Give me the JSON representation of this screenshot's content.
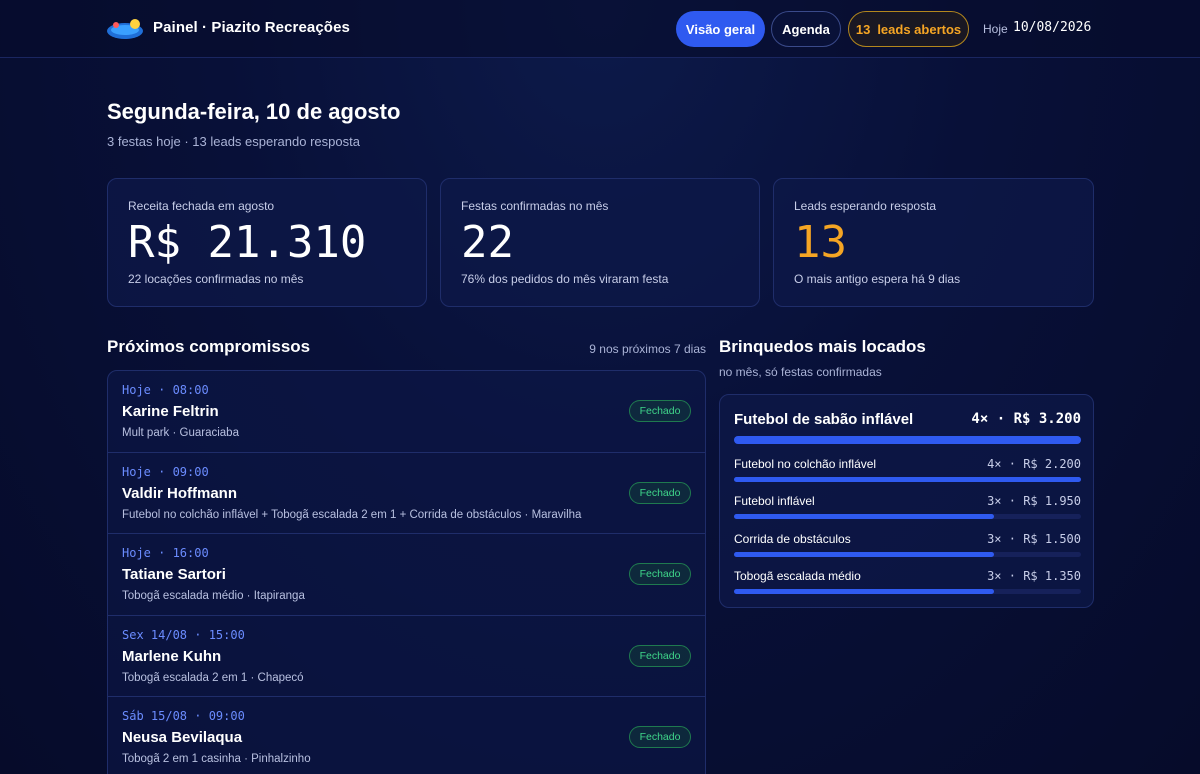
{
  "header": {
    "brand": "Painel · Piazito Recreações",
    "nav": {
      "overview": "Visão geral",
      "agenda": "Agenda",
      "leads_count": "13",
      "leads_label": "leads abertos"
    },
    "today_label": "Hoje",
    "today_date": "10/08/2026"
  },
  "page": {
    "title": "Segunda-feira, 10 de agosto",
    "subtitle": "3 festas hoje · 13 leads esperando resposta"
  },
  "kpis": [
    {
      "label": "Receita fechada em agosto",
      "value": "R$ 21.310",
      "note": "22 locações confirmadas no mês"
    },
    {
      "label": "Festas confirmadas no mês",
      "value": "22",
      "note": "76% dos pedidos do mês viraram festa"
    },
    {
      "label": "Leads esperando resposta",
      "value": "13",
      "note": "O mais antigo espera há 9 dias"
    }
  ],
  "appointments": {
    "title": "Próximos compromissos",
    "meta": "9 nos próximos 7 dias",
    "items": [
      {
        "time": "Hoje · 08:00",
        "name": "Karine Feltrin",
        "desc": "Mult park · Guaraciaba",
        "status": "Fechado"
      },
      {
        "time": "Hoje · 09:00",
        "name": "Valdir Hoffmann",
        "desc": "Futebol no colchão inflável + Tobogã escalada 2 em 1 + Corrida de obstáculos · Maravilha",
        "status": "Fechado"
      },
      {
        "time": "Hoje · 16:00",
        "name": "Tatiane Sartori",
        "desc": "Tobogã escalada médio · Itapiranga",
        "status": "Fechado"
      },
      {
        "time": "Sex 14/08 · 15:00",
        "name": "Marlene Kuhn",
        "desc": "Tobogã escalada 2 em 1 · Chapecó",
        "status": "Fechado"
      },
      {
        "time": "Sáb 15/08 · 09:00",
        "name": "Neusa Bevilaqua",
        "desc": "Tobogã 2 em 1 casinha · Pinhalzinho",
        "status": "Fechado"
      }
    ]
  },
  "toys": {
    "title": "Brinquedos mais locados",
    "subtitle": "no mês, só festas confirmadas",
    "items": [
      {
        "name": "Futebol de sabão inflável",
        "stat": "4× · R$ 3.200",
        "level": 1.0
      },
      {
        "name": "Futebol no colchão inflável",
        "stat": "4× · R$ 2.200",
        "level": 1.0
      },
      {
        "name": "Futebol inflável",
        "stat": "3× · R$ 1.950",
        "level": 0.75
      },
      {
        "name": "Corrida de obstáculos",
        "stat": "3× · R$ 1.500",
        "level": 0.75
      },
      {
        "name": "Tobogã escalada médio",
        "stat": "3× · R$ 1.350",
        "level": 0.75
      }
    ]
  },
  "colors": {
    "accent": "#2f5af0",
    "warning": "#f5a524",
    "success": "#3fd68a"
  }
}
